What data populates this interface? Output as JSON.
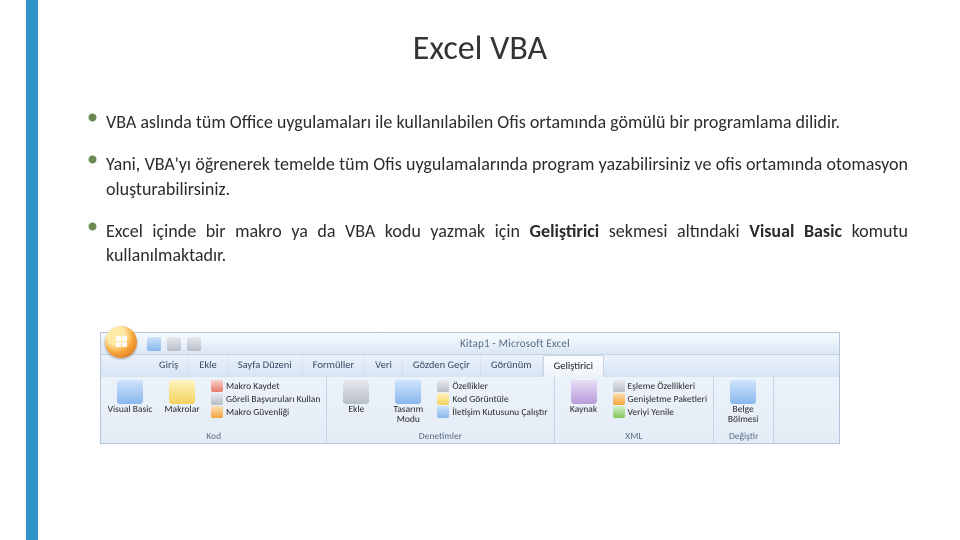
{
  "slide": {
    "title": "Excel VBA",
    "bullets": [
      {
        "prefix": "VBA aslında tüm Office uygulamaları ile kullanılabilen Ofis ortamında gömülü bir programlama dilidir."
      },
      {
        "prefix": "Yani, VBA'yı öğrenerek temelde tüm Ofis uygulamalarında program yazabilirsiniz ve ofis ortamında otomasyon oluşturabilirsiniz."
      },
      {
        "prefix": "Excel içinde bir makro ya da VBA kodu yazmak için ",
        "bold1": "Geliştirici",
        "mid": " sekmesi altındaki ",
        "bold2": "Visual Basic",
        "suffix": " komutu kullanılmaktadır."
      }
    ],
    "accent_color": "#2f93c9",
    "bullet_glyph_color": "#4b6b43"
  },
  "ribbon": {
    "app_title": "Kitap1 - Microsoft Excel",
    "tabs": [
      "Giriş",
      "Ekle",
      "Sayfa Düzeni",
      "Formüller",
      "Veri",
      "Gözden Geçir",
      "Görünüm",
      "Geliştirici"
    ],
    "active_tab_index": 7,
    "groups": {
      "kod": {
        "label": "Kod",
        "visual_basic": "Visual Basic",
        "makrolar": "Makrolar",
        "makro_kaydet": "Makro Kaydet",
        "goreli": "Göreli Başvuruları Kullan",
        "guvenlik": "Makro Güvenliği"
      },
      "denetimler": {
        "label": "Denetimler",
        "ekle": "Ekle",
        "tasarim": "Tasarım Modu",
        "ozellikler": "Özellikler",
        "kod_goruntule": "Kod Görüntüle",
        "ileti": "İletişim Kutusunu Çalıştır"
      },
      "xml": {
        "label": "XML",
        "kaynak": "Kaynak",
        "eslemeler": "Eşleme Özellikleri",
        "genisletme": "Genişletme Paketleri",
        "veri": "Veriyi Yenile"
      },
      "degistir": {
        "label": "Değiştir",
        "belge": "Belge Bölmesi"
      }
    }
  }
}
